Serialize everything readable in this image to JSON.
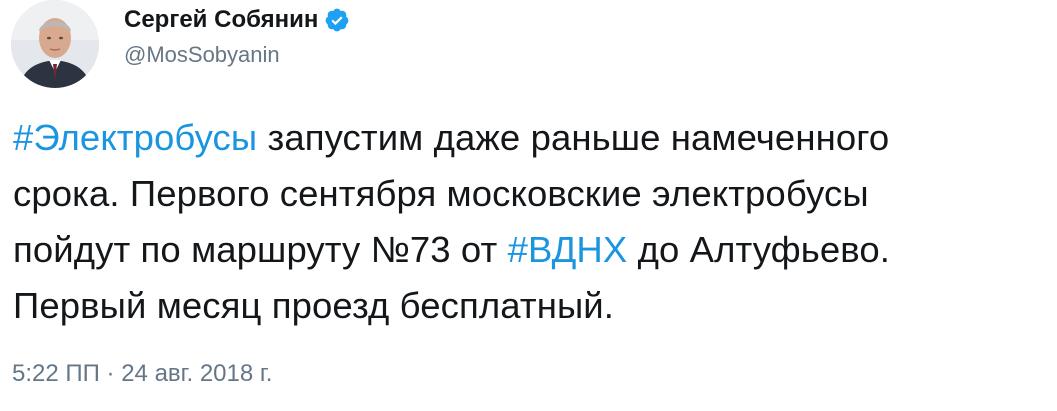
{
  "author": {
    "display_name": "Сергей Собянин",
    "handle": "@MosSobyanin",
    "verified": true,
    "avatar_icon": "avatar-portrait",
    "verified_icon": "verified-badge-icon",
    "verified_color": "#1da1f2"
  },
  "tweet": {
    "lines": [
      [
        {
          "text": "#Электробусы",
          "hashtag": true
        },
        {
          "text": " запустим даже раньше намеченного",
          "hashtag": false
        }
      ],
      [
        {
          "text": "срока. Первого сентября московские электробусы",
          "hashtag": false
        }
      ],
      [
        {
          "text": "пойдут по маршруту №73 от ",
          "hashtag": false
        },
        {
          "text": "#ВДНХ",
          "hashtag": true
        },
        {
          "text": " до Алтуфьево.",
          "hashtag": false
        }
      ],
      [
        {
          "text": "Первый месяц проезд бесплатный.",
          "hashtag": false
        }
      ]
    ],
    "hashtag_color": "#1b95e0"
  },
  "meta": {
    "timestamp": "5:22 ПП · 24 авг. 2018 г."
  }
}
